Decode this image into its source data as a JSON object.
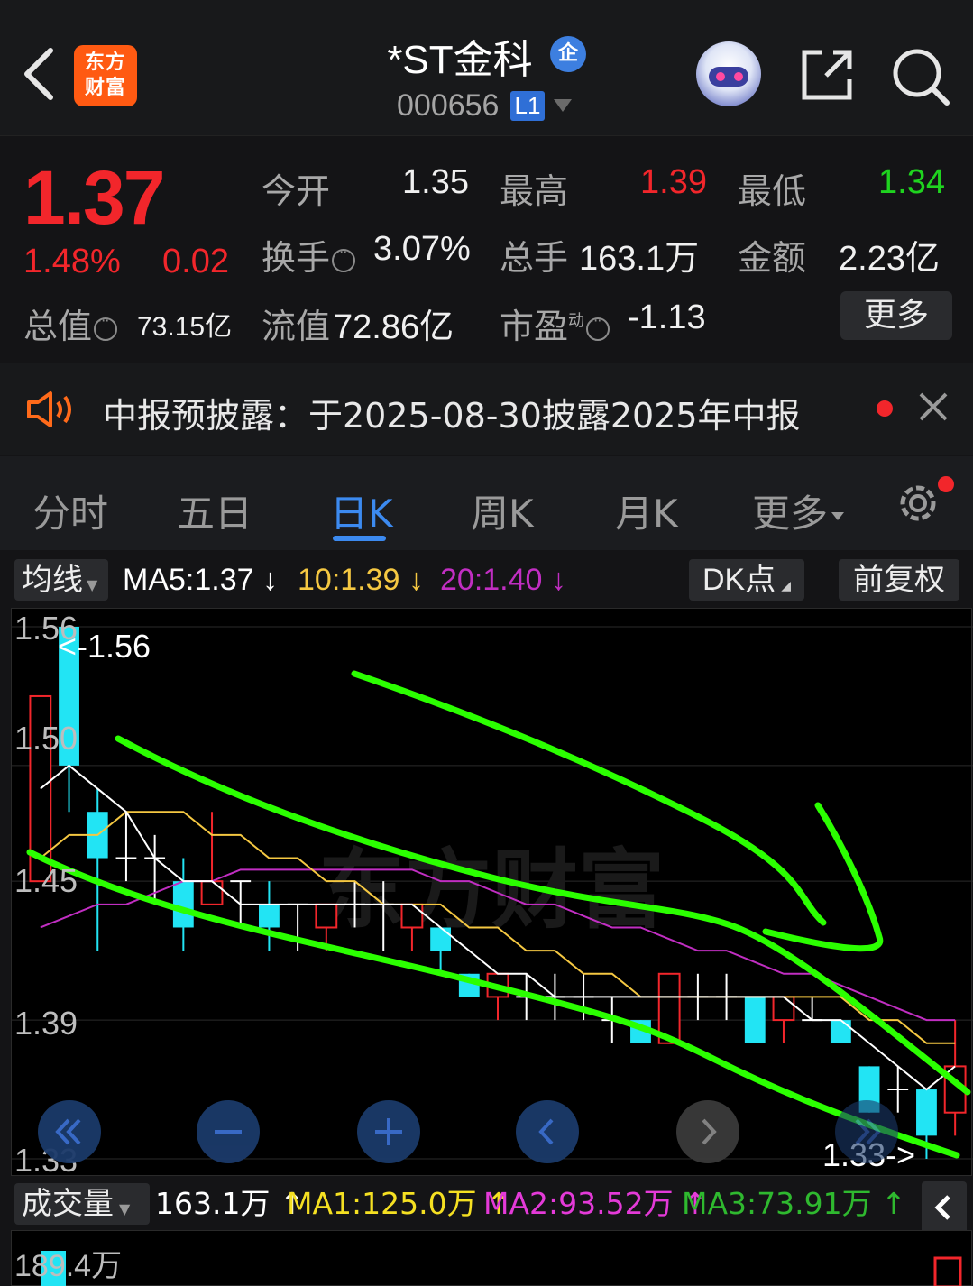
{
  "header": {
    "logo_text": "东方财富",
    "title": "*ST金科",
    "badge_qi": "企",
    "code": "000656",
    "level": "L1"
  },
  "quote": {
    "price": "1.37",
    "change_pct": "1.48%",
    "change": "0.02",
    "rows": [
      [
        {
          "label": "今开",
          "value": "1.35"
        },
        {
          "label": "最高",
          "value": "1.39"
        },
        {
          "label": "最低",
          "value": "1.34"
        }
      ],
      [
        {
          "label": "换手",
          "value": "3.07%"
        },
        {
          "label": "总手",
          "value": "163.1万"
        },
        {
          "label": "金额",
          "value": "2.23亿"
        }
      ],
      [
        {
          "label": "总值",
          "value": "73.15亿"
        },
        {
          "label": "流值",
          "value": "72.86亿"
        },
        {
          "label": "市盈",
          "sup": "动",
          "value": "-1.13"
        }
      ]
    ],
    "more_button": "更多"
  },
  "notice": {
    "text": "中报预披露：于2025-08-30披露2025年中报"
  },
  "tabs": [
    "分时",
    "五日",
    "日K",
    "周K",
    "月K",
    "更多"
  ],
  "active_tab": "日K",
  "ma_bar": {
    "select": "均线",
    "ma5": "MA5:1.37",
    "ma10": "10:1.39",
    "ma20": "20:1.40",
    "dk_button": "DK点",
    "fq_button": "前复权"
  },
  "chart_data": {
    "type": "candlestick",
    "y_ticks": [
      "1.56",
      "1.50",
      "1.45",
      "1.39",
      "1.33"
    ],
    "high_annotation": "<-1.56",
    "low_annotation": "1.33->",
    "ylim": [
      1.33,
      1.56
    ],
    "colors": {
      "up": "#f2262b",
      "down": "#22e4f4",
      "ma5": "#ffffff",
      "ma10": "#f5c842",
      "ma20": "#c12ec2",
      "drawing": "#2bff00"
    },
    "candles": [
      {
        "o": 1.45,
        "h": 1.53,
        "l": 1.45,
        "c": 1.53
      },
      {
        "o": 1.56,
        "h": 1.56,
        "l": 1.48,
        "c": 1.5
      },
      {
        "o": 1.48,
        "h": 1.49,
        "l": 1.42,
        "c": 1.46
      },
      {
        "o": 1.46,
        "h": 1.48,
        "l": 1.45,
        "c": 1.46
      },
      {
        "o": 1.46,
        "h": 1.47,
        "l": 1.44,
        "c": 1.46
      },
      {
        "o": 1.45,
        "h": 1.46,
        "l": 1.42,
        "c": 1.43
      },
      {
        "o": 1.44,
        "h": 1.48,
        "l": 1.44,
        "c": 1.45
      },
      {
        "o": 1.45,
        "h": 1.45,
        "l": 1.43,
        "c": 1.45
      },
      {
        "o": 1.44,
        "h": 1.45,
        "l": 1.42,
        "c": 1.43
      },
      {
        "o": 1.44,
        "h": 1.44,
        "l": 1.42,
        "c": 1.44
      },
      {
        "o": 1.43,
        "h": 1.44,
        "l": 1.42,
        "c": 1.44
      },
      {
        "o": 1.44,
        "h": 1.45,
        "l": 1.43,
        "c": 1.44
      },
      {
        "o": 1.44,
        "h": 1.45,
        "l": 1.42,
        "c": 1.44
      },
      {
        "o": 1.43,
        "h": 1.44,
        "l": 1.42,
        "c": 1.44
      },
      {
        "o": 1.43,
        "h": 1.43,
        "l": 1.41,
        "c": 1.42
      },
      {
        "o": 1.41,
        "h": 1.41,
        "l": 1.4,
        "c": 1.4
      },
      {
        "o": 1.4,
        "h": 1.41,
        "l": 1.39,
        "c": 1.41
      },
      {
        "o": 1.4,
        "h": 1.41,
        "l": 1.39,
        "c": 1.4
      },
      {
        "o": 1.4,
        "h": 1.41,
        "l": 1.39,
        "c": 1.4
      },
      {
        "o": 1.4,
        "h": 1.41,
        "l": 1.39,
        "c": 1.4
      },
      {
        "o": 1.39,
        "h": 1.4,
        "l": 1.38,
        "c": 1.39
      },
      {
        "o": 1.39,
        "h": 1.39,
        "l": 1.38,
        "c": 1.38
      },
      {
        "o": 1.38,
        "h": 1.41,
        "l": 1.38,
        "c": 1.41
      },
      {
        "o": 1.4,
        "h": 1.41,
        "l": 1.39,
        "c": 1.4
      },
      {
        "o": 1.4,
        "h": 1.41,
        "l": 1.39,
        "c": 1.4
      },
      {
        "o": 1.4,
        "h": 1.4,
        "l": 1.38,
        "c": 1.38
      },
      {
        "o": 1.39,
        "h": 1.4,
        "l": 1.38,
        "c": 1.4
      },
      {
        "o": 1.39,
        "h": 1.4,
        "l": 1.39,
        "c": 1.39
      },
      {
        "o": 1.39,
        "h": 1.39,
        "l": 1.38,
        "c": 1.38
      },
      {
        "o": 1.37,
        "h": 1.37,
        "l": 1.35,
        "c": 1.35
      },
      {
        "o": 1.36,
        "h": 1.37,
        "l": 1.35,
        "c": 1.36
      },
      {
        "o": 1.36,
        "h": 1.36,
        "l": 1.33,
        "c": 1.34
      },
      {
        "o": 1.35,
        "h": 1.39,
        "l": 1.34,
        "c": 1.37
      }
    ],
    "ma5": [
      1.49,
      1.5,
      1.49,
      1.48,
      1.46,
      1.45,
      1.45,
      1.44,
      1.44,
      1.44,
      1.44,
      1.44,
      1.44,
      1.44,
      1.43,
      1.42,
      1.41,
      1.41,
      1.4,
      1.4,
      1.4,
      1.4,
      1.4,
      1.4,
      1.4,
      1.4,
      1.4,
      1.39,
      1.39,
      1.38,
      1.37,
      1.36,
      1.37
    ],
    "ma10": [
      1.46,
      1.47,
      1.47,
      1.48,
      1.48,
      1.48,
      1.47,
      1.47,
      1.46,
      1.46,
      1.45,
      1.45,
      1.44,
      1.44,
      1.44,
      1.43,
      1.43,
      1.42,
      1.42,
      1.41,
      1.41,
      1.4,
      1.4,
      1.4,
      1.4,
      1.4,
      1.4,
      1.4,
      1.4,
      1.39,
      1.39,
      1.38,
      1.38
    ],
    "ma20": [
      1.43,
      1.435,
      1.44,
      1.44,
      1.445,
      1.45,
      1.45,
      1.455,
      1.455,
      1.455,
      1.455,
      1.455,
      1.455,
      1.455,
      1.45,
      1.45,
      1.445,
      1.44,
      1.44,
      1.435,
      1.43,
      1.43,
      1.425,
      1.42,
      1.42,
      1.415,
      1.41,
      1.41,
      1.405,
      1.4,
      1.395,
      1.39,
      1.39
    ]
  },
  "volume_bar": {
    "select": "成交量",
    "value": "163.1万",
    "ma1": "MA1:125.0万",
    "ma2": "MA2:93.52万",
    "ma3": "MA3:73.91万",
    "top_label": "189.4万"
  }
}
